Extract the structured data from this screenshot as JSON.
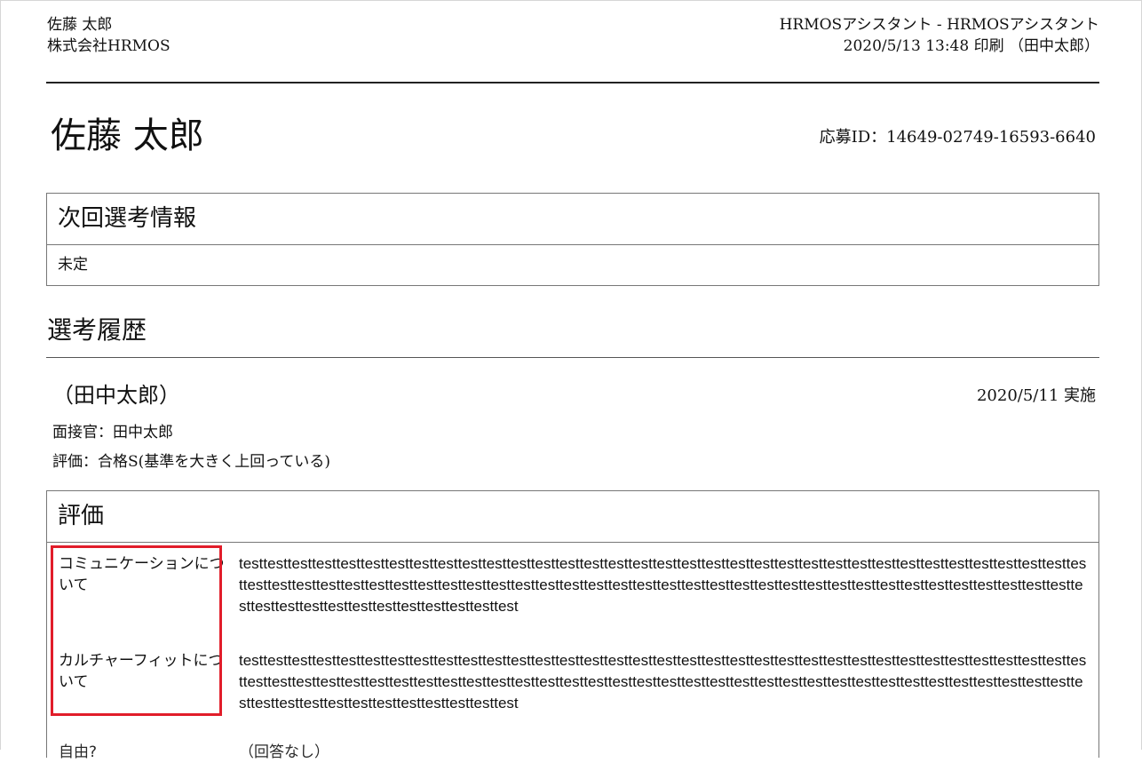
{
  "header": {
    "candidate_name": "佐藤 太郎",
    "company": "株式会社HRMOS",
    "app_title": "HRMOSアシスタント - HRMOSアシスタント",
    "print_info": "2020/5/13 13:48 印刷 （田中太郎）"
  },
  "candidate": {
    "name": "佐藤 太郎",
    "application_id": "応募ID：14649-02749-16593-6640"
  },
  "next_selection": {
    "heading": "次回選考情報",
    "value": "未定"
  },
  "history": {
    "heading": "選考履歴",
    "entry": {
      "interviewer_display": "（田中太郎）",
      "date": "2020/5/11 実施",
      "interviewer_line": "面接官：田中太郎",
      "rating_line": "評価：合格S(基準を大きく上回っている)"
    }
  },
  "evaluation": {
    "heading": "評価",
    "rows": [
      {
        "label": "コミュニケーションについて",
        "value": "testtesttesttesttesttesttesttesttesttesttesttesttesttesttesttesttesttesttesttesttesttesttesttesttesttesttesttesttesttesttesttesttesttesttesttesttesttesttesttesttesttesttesttesttesttesttesttesttesttesttesttesttesttesttesttesttesttesttesttesttesttesttesttesttesttesttesttesttesttesttesttesttesttesttesttesttesttesttesttesttest"
      },
      {
        "label": "カルチャーフィットについて",
        "value": "testtesttesttesttesttesttesttesttesttesttesttesttesttesttesttesttesttesttesttesttesttesttesttesttesttesttesttesttesttesttesttesttesttesttesttesttesttesttesttesttesttesttesttesttesttesttesttesttesttesttesttesttesttesttesttesttesttesttesttesttesttesttesttesttesttesttesttesttesttesttesttesttesttesttesttesttesttesttesttesttest"
      },
      {
        "label": "自由?",
        "value": "（回答なし）"
      }
    ]
  },
  "colors": {
    "highlight_border": "#e11d2a"
  }
}
